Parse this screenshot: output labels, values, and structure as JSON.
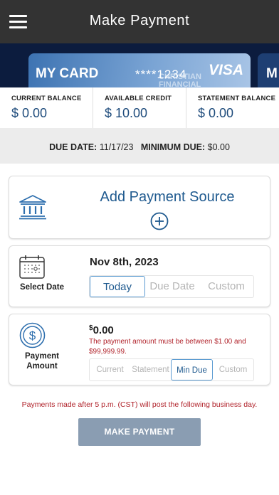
{
  "header": {
    "title": "Make Payment"
  },
  "card": {
    "name": "MY CARD",
    "number": "****1234",
    "bank_line1": "CHRISTIAN",
    "bank_line2": "FINANCIAL",
    "network": "VISA",
    "next_card_initial": "M"
  },
  "balances": [
    {
      "label": "CURRENT BALANCE",
      "value": "$ 0.00"
    },
    {
      "label": "AVAILABLE CREDIT",
      "value": "$ 10.00"
    },
    {
      "label": "STATEMENT BALANCE",
      "value": "$ 0.00"
    }
  ],
  "due": {
    "due_label": "DUE DATE:",
    "due_value": "11/17/23",
    "min_label": "MINIMUM DUE:",
    "min_value": "$0.00"
  },
  "source": {
    "title": "Add Payment Source",
    "icon": "bank-icon"
  },
  "date_panel": {
    "label": "Select Date",
    "selected_date": "Nov 8th, 2023",
    "options": [
      "Today",
      "Due Date",
      "Custom"
    ],
    "active": "Today"
  },
  "amount_panel": {
    "label_line1": "Payment",
    "label_line2": "Amount",
    "currency": "$",
    "amount": "0.00",
    "error": "The payment amount must be between $1.00 and $99,999.99.",
    "options": [
      "Current",
      "Statement",
      "Min Due",
      "Custom"
    ],
    "active": "Min Due"
  },
  "notice": "Payments made after 5 p.m. (CST) will post the following business day.",
  "pay_button": "MAKE PAYMENT",
  "colors": {
    "header_bg": "#333333",
    "accent": "#1f5a8f",
    "error": "#b0222a",
    "button_bg": "#8a9db2"
  }
}
